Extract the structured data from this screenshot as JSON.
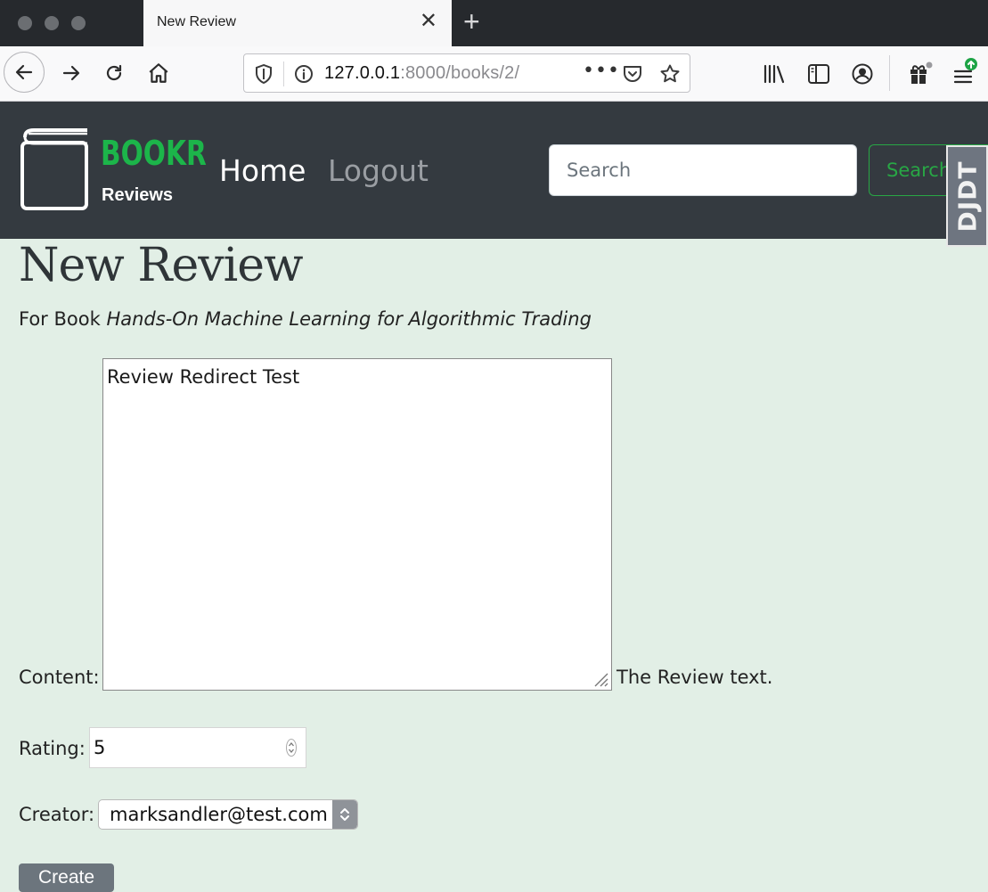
{
  "browser": {
    "tab_title": "New Review",
    "url_host": "127.0.0.1",
    "url_rest": ":8000/books/2/"
  },
  "navbar": {
    "brand_name": "BOOKR",
    "brand_tagline": "Reviews",
    "links": [
      {
        "label": "Home",
        "active": true
      },
      {
        "label": "Logout",
        "active": false
      }
    ],
    "search_placeholder": "Search",
    "search_button": "Search",
    "debug_toolbar_label": "DJDT",
    "brand_color": "#1cb54a"
  },
  "page": {
    "title": "New Review",
    "book_prefix": "For Book",
    "book_title": "Hands-On Machine Learning for Algorithmic Trading"
  },
  "form": {
    "content_label": "Content:",
    "content_value": "Review Redirect Test",
    "content_help": "The Review text.",
    "rating_label": "Rating:",
    "rating_value": "5",
    "creator_label": "Creator:",
    "creator_value": "marksandler@test.com",
    "submit_label": "Create"
  }
}
